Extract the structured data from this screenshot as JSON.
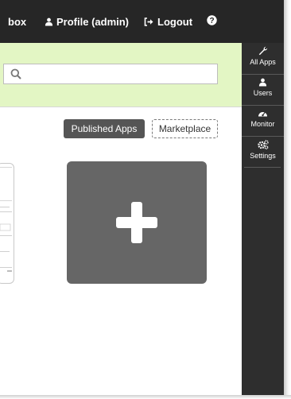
{
  "topbar": {
    "sandbox_partial": "box",
    "profile": "Profile (admin)",
    "logout": "Logout"
  },
  "rail": {
    "items": [
      {
        "label": "All Apps",
        "icon": "wrench-icon"
      },
      {
        "label": "Users",
        "icon": "user-icon"
      },
      {
        "label": "Monitor",
        "icon": "gauge-icon"
      },
      {
        "label": "Settings",
        "icon": "gears-icon"
      }
    ]
  },
  "search": {
    "placeholder": ""
  },
  "tabs": {
    "published": "Published Apps",
    "marketplace": "Marketplace"
  },
  "colors": {
    "topbar": "#262626",
    "rail": "#2e2e2e",
    "banner": "#e3f6c4",
    "published_bg": "#555555",
    "add_tile": "#666666"
  }
}
